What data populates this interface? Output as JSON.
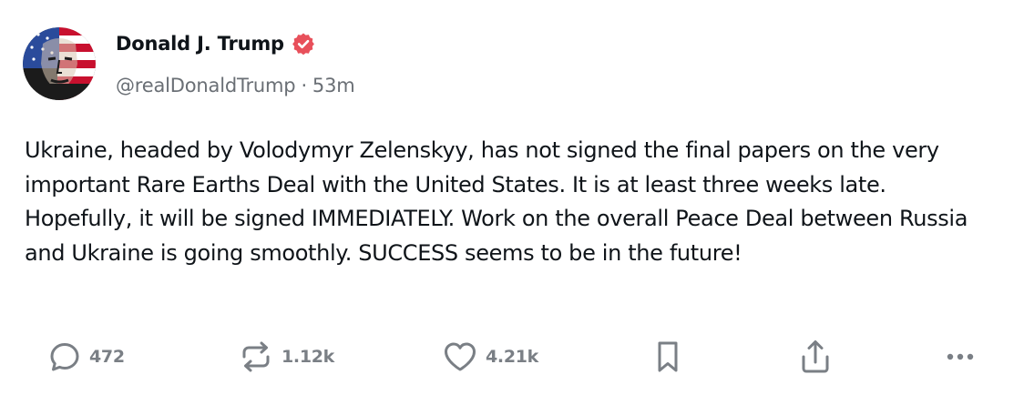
{
  "post": {
    "author": {
      "display_name": "Donald J. Trump",
      "handle": "@realDonaldTrump",
      "separator": "·",
      "time_ago": "53m",
      "verified": true,
      "avatar_icon": "avatar-image"
    },
    "text": "Ukraine, headed by Volodymyr Zelenskyy, has not signed the final papers on the very important Rare Earths Deal with the United States. It is at least three weeks late. Hopefully, it will be signed IMMEDIATELY. Work on the overall Peace Deal between Russia and Ukraine is going smoothly. SUCCESS seems to be in the future!",
    "actions": {
      "reply": {
        "icon": "reply-icon",
        "count": "472"
      },
      "repost": {
        "icon": "repost-icon",
        "count": "1.12k"
      },
      "like": {
        "icon": "heart-icon",
        "count": "4.21k"
      },
      "bookmark": {
        "icon": "bookmark-icon"
      },
      "share": {
        "icon": "share-icon"
      },
      "more": {
        "icon": "more-icon"
      }
    }
  },
  "colors": {
    "text": "#0f1419",
    "muted": "#6a6f75",
    "icon": "#7a7f85",
    "verified": "#e8505b"
  }
}
